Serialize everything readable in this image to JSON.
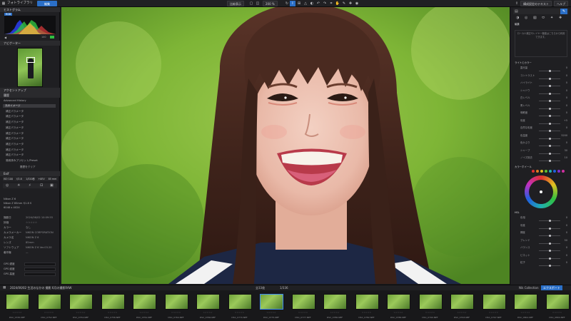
{
  "topbar": {
    "app_title": "フォトライブラリ",
    "edit_label": "編集",
    "compare_label": "比較表示",
    "zoom_label": "200 %",
    "export_button": "構成設定のテキスト",
    "help_button": "ヘルプ",
    "workspace_label": "アドビル"
  },
  "left": {
    "histogram_header": "ヒストグラム",
    "histogram_tag": "RGB",
    "histogram_value": "100",
    "navigator_header": "ナビゲーター",
    "adjust_header": "アクセントアップ",
    "history_header": "履歴",
    "history_title": "Advanced History",
    "history_items": [
      "元のイメージ",
      "補正パラメータ",
      "補正パラメータ",
      "補正パラメータ",
      "補正パラメータ",
      "補正パラメータ",
      "補正パラメータ",
      "補正パラメータ",
      "補正パラメータ",
      "補正パラメータ",
      "適用済みプリセット/Preset"
    ],
    "history_button": "履歴をクリア",
    "exif_header": "Exif",
    "exif_values": [
      "ISO 100",
      "f/2.8",
      "1/320秒",
      "+0EV",
      "85 mm"
    ],
    "camera_label": "Nikon Z 6",
    "lens_label": "Nikon Z 85mm f/1.8 S",
    "size_label": "6048 x 4024",
    "meta_rows": [
      {
        "k": "撮影日",
        "v": "2024/06/02 10:09:55"
      },
      {
        "k": "評価",
        "v": "☆☆☆☆☆"
      },
      {
        "k": "カラー",
        "v": "なし"
      },
      {
        "k": "カメラメーカー",
        "v": "NIKON CORPORATION"
      },
      {
        "k": "カメラ名",
        "v": "NIKON Z 6"
      },
      {
        "k": "レンズ",
        "v": "85mm"
      },
      {
        "k": "ソフトウェア",
        "v": "NIKON Z 6 Ver.03.20"
      },
      {
        "k": "著作権",
        "v": "—"
      }
    ],
    "gps_labels": [
      "GPS 緯度",
      "GPS 経度",
      "GPS 高度"
    ]
  },
  "right": {
    "tools_title": "編集",
    "notice": "ローカル補正やレイヤー機能はこちらから利用できます。",
    "section_light": "ライトとカラー",
    "section_detail": "詳細",
    "section_color": "カラーホイール",
    "section_hsl": "HSL",
    "sliders": [
      {
        "label": "露光量",
        "val": "0"
      },
      {
        "label": "コントラスト",
        "val": "0"
      },
      {
        "label": "ハイライト",
        "val": "0"
      },
      {
        "label": "シャドウ",
        "val": "0"
      },
      {
        "label": "白レベル",
        "val": "0"
      },
      {
        "label": "黒レベル",
        "val": "0"
      },
      {
        "label": "明瞭度",
        "val": "0"
      },
      {
        "label": "彩度",
        "val": "+5"
      },
      {
        "label": "自然な彩度",
        "val": "0"
      },
      {
        "label": "色温度",
        "val": "5200"
      },
      {
        "label": "色かぶり",
        "val": "0"
      },
      {
        "label": "シャープ",
        "val": "30"
      },
      {
        "label": "ノイズ除去",
        "val": "10"
      }
    ],
    "lower_sliders": [
      {
        "label": "色相",
        "val": "0"
      },
      {
        "label": "彩度",
        "val": "0"
      },
      {
        "label": "輝度",
        "val": "0"
      },
      {
        "label": "ブレンド",
        "val": "50"
      },
      {
        "label": "バランス",
        "val": "0"
      },
      {
        "label": "ビネット",
        "val": "0"
      },
      {
        "label": "粒子",
        "val": "0"
      }
    ],
    "swatch_colors": [
      "#e03030",
      "#e07a20",
      "#e0c020",
      "#60c030",
      "#20b0b0",
      "#2060e0",
      "#8030d0",
      "#d030a0"
    ]
  },
  "filmstrip": {
    "folder": "2024/06/02 生活のなかの 撮影 6月の撮影RAW",
    "count": "全33枚",
    "selected": "1/336",
    "collection": "Nik Collection",
    "export": "エクスポート",
    "thumbs": [
      "DSC_0745.NEF",
      "DSC_0752.NEF",
      "DSC_0754.NEF",
      "DSC_0758.NEF",
      "DSC_0761.NEF",
      "DSC_0764.NEF",
      "DSC_0766.NEF",
      "DSC_0770.NEF",
      "DSC_0775.NEF",
      "DSC_0777.NEF",
      "DSC_0780.NEF",
      "DSC_0782.NEF",
      "DSC_0786.NEF",
      "DSC_0790.NEF",
      "DSC_0793.NEF",
      "DSC_0797.NEF",
      "DSC_0801.NEF",
      "DSC_0804.NEF"
    ]
  }
}
